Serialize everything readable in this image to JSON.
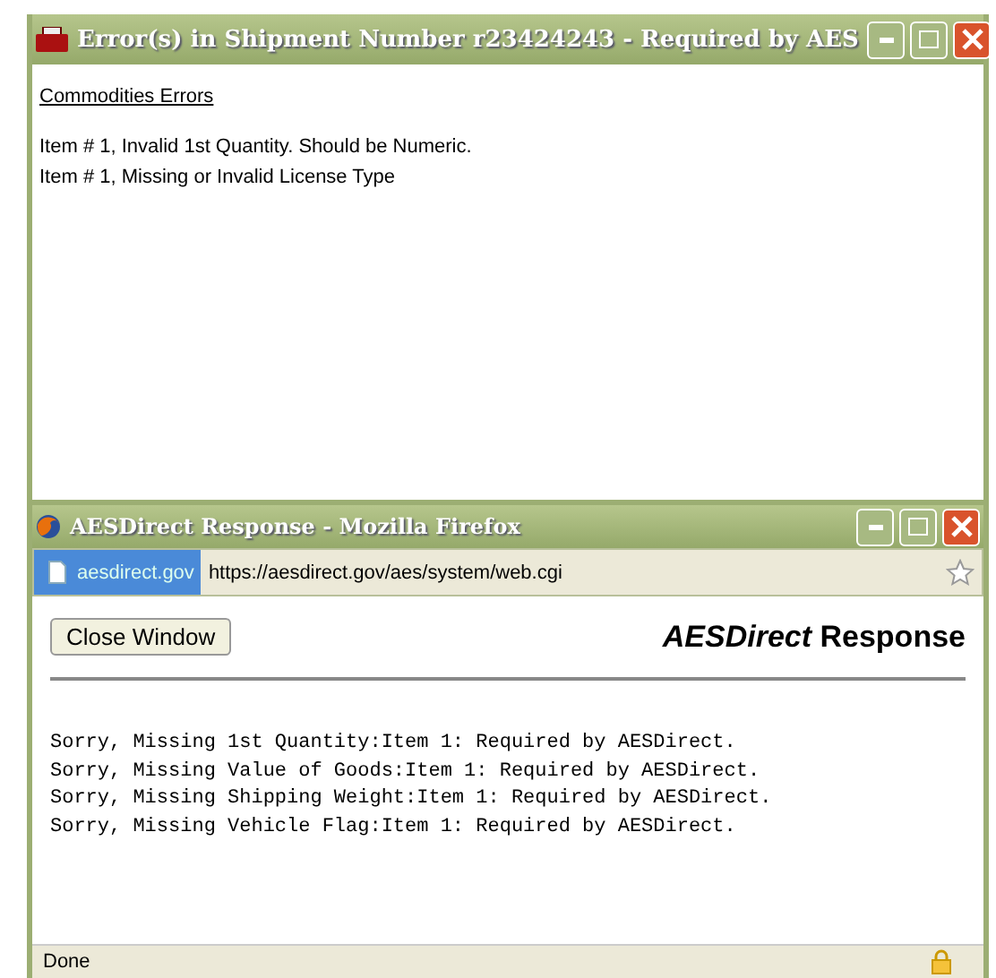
{
  "error_window": {
    "title": "Error(s) in Shipment Number r23424243 - Required by AES",
    "section_title": "Commodities Errors",
    "errors": [
      "Item # 1, Invalid 1st Quantity. Should be Numeric.",
      "Item # 1, Missing or Invalid License Type"
    ]
  },
  "browser_window": {
    "title": "AESDirect Response - Mozilla Firefox",
    "site_badge": "aesdirect.gov",
    "url": "https://aesdirect.gov/aes/system/web.cgi",
    "close_button": "Close Window",
    "heading": "*AESDirect* Response",
    "messages": [
      "Sorry, Missing 1st Quantity:Item 1: Required by AESDirect.",
      "Sorry, Missing Value of Goods:Item 1: Required by AESDirect.",
      "Sorry, Missing Shipping Weight:Item 1: Required by AESDirect.",
      "Sorry, Missing Vehicle Flag:Item 1: Required by AESDirect."
    ],
    "status": "Done"
  }
}
